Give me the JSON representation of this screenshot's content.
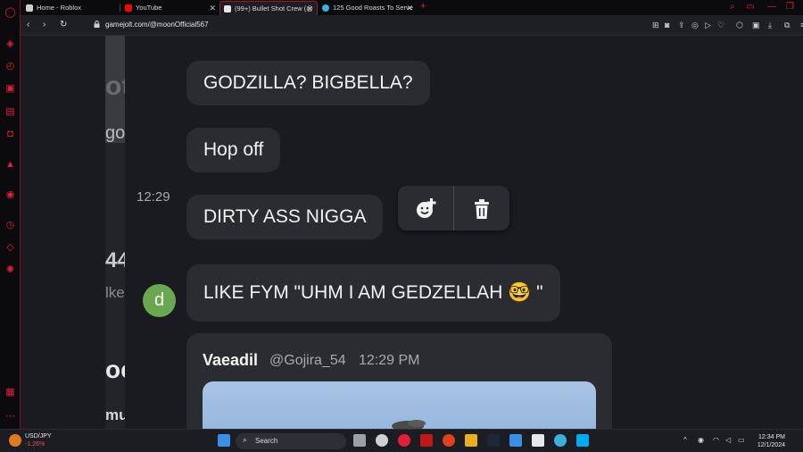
{
  "tabs": [
    {
      "title": "Home - Roblox",
      "color": "#cfcfcf"
    },
    {
      "title": "YouTube",
      "color": "#ff0000"
    },
    {
      "title": "(99+) Bullet Shot Crew (@",
      "color": "#ffffff"
    },
    {
      "title": "125 Good Roasts To Serve",
      "color": "#3ab0e0"
    }
  ],
  "address": {
    "url": "gamejolt.com/@moonOfficial567"
  },
  "left_fragments": [
    "ot",
    "go",
    "44",
    "lkes",
    "oc",
    "mu"
  ],
  "messages": [
    {
      "text": "GODZILLA? BIGBELLA?"
    },
    {
      "text": "Hop off"
    },
    {
      "text": "DIRTY ASS NIGGA"
    },
    {
      "text": "LIKE FYM \"UHM I AM GEDZELLAH 🤓 \""
    }
  ],
  "timestamp": "12:29",
  "avatar_letter": "d",
  "embed": {
    "name": "Vaeadil",
    "handle": "@Gojira_54",
    "time": "12:29 PM"
  },
  "taskbar": {
    "stock_name": "USD/JPY",
    "stock_change": "-1.26%",
    "search_label": "Search",
    "time": "12:34 PM",
    "date": "12/1/2024"
  },
  "colors": {
    "accent": "#e0203a",
    "bubble": "#2b2c31",
    "avatar": "#6aa84f"
  }
}
